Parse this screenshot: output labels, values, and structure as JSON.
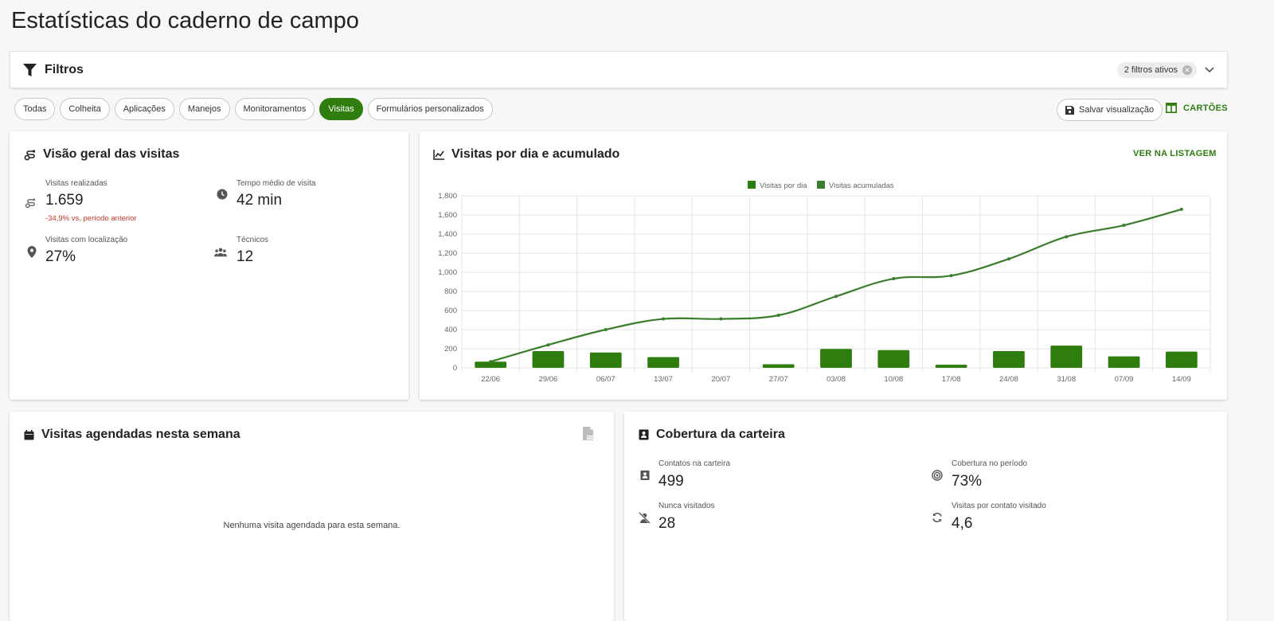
{
  "page": {
    "title": "Estatísticas do caderno de campo"
  },
  "filters": {
    "title": "Filtros",
    "active_label": "2 filtros ativos"
  },
  "tabs": [
    {
      "label": "Todas",
      "active": false
    },
    {
      "label": "Colheita",
      "active": false
    },
    {
      "label": "Aplicações",
      "active": false
    },
    {
      "label": "Manejos",
      "active": false
    },
    {
      "label": "Monitoramentos",
      "active": false
    },
    {
      "label": "Visitas",
      "active": true
    },
    {
      "label": "Formulários personalizados",
      "active": false
    }
  ],
  "toolbar": {
    "save_label": "Salvar visualização",
    "cards_label": "CARTÕES"
  },
  "overview": {
    "title": "Visão geral das visitas",
    "visits_done": {
      "label": "Visitas realizadas",
      "value": "1.659",
      "change": "-34,9% vs. período anterior",
      "icon": "visits-icon"
    },
    "avg_time": {
      "label": "Tempo médio de visita",
      "value": "42 min",
      "icon": "clock-icon"
    },
    "with_location": {
      "label": "Visitas com localização",
      "value": "27%",
      "icon": "location-pin-icon"
    },
    "technicians": {
      "label": "Técnicos",
      "value": "12",
      "icon": "people-icon"
    }
  },
  "chart_card": {
    "title": "Visitas por dia e acumulado",
    "link_label": "VER NA LISTAGEM"
  },
  "chart_data": {
    "type": "bar",
    "categories": [
      "22/06",
      "29/06",
      "06/07",
      "13/07",
      "20/07",
      "27/07",
      "03/08",
      "10/08",
      "17/08",
      "24/08",
      "31/08",
      "07/09",
      "14/09"
    ],
    "series": [
      {
        "name": "Visitas por dia",
        "type": "bar",
        "values": [
          65,
          175,
          160,
          112,
          0,
          38,
          198,
          185,
          32,
          175,
          232,
          120,
          170
        ],
        "color": "#2e7d0e"
      },
      {
        "name": "Visitas acumuladas",
        "type": "line",
        "values": [
          65,
          240,
          400,
          512,
          512,
          550,
          748,
          933,
          965,
          1140,
          1372,
          1492,
          1659
        ],
        "color": "#3a7d2c"
      }
    ],
    "ylim": [
      0,
      1800
    ],
    "yticks": [
      "0",
      "200",
      "400",
      "600",
      "800",
      "1,000",
      "1,200",
      "1,400",
      "1,600",
      "1,800"
    ],
    "grid": true,
    "legend_position": "top-center"
  },
  "scheduled": {
    "title": "Visitas agendadas nesta semana",
    "empty_message": "Nenhuma visita agendada para esta semana."
  },
  "coverage": {
    "title": "Cobertura da carteira",
    "contacts": {
      "label": "Contatos na carteira",
      "value": "499",
      "icon": "contacts-book-icon"
    },
    "coverage_period": {
      "label": "Cobertura no período",
      "value": "73%",
      "icon": "target-icon"
    },
    "never_visited": {
      "label": "Nunca visitados",
      "value": "28",
      "icon": "person-off-icon"
    },
    "visits_per_contact": {
      "label": "Visitas por contato visitado",
      "value": "4,6",
      "icon": "refresh-icon"
    }
  }
}
